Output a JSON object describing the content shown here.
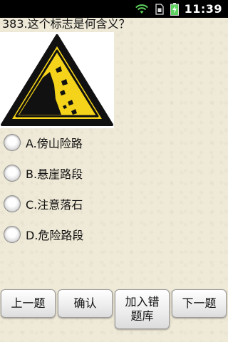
{
  "status_bar": {
    "time": "11:39",
    "icons": [
      "wifi-icon",
      "sim-icon",
      "battery-charging-icon"
    ]
  },
  "question": {
    "text": "383.这个标志是何含义？"
  },
  "sign": {
    "icon": "falling-rocks-warning-sign",
    "colors": {
      "yellow": "#f4d31a",
      "black": "#111111"
    }
  },
  "options": [
    {
      "label": "A.傍山险路"
    },
    {
      "label": "B.悬崖路段"
    },
    {
      "label": "C.注意落石"
    },
    {
      "label": "D.危险路段"
    }
  ],
  "buttons": {
    "prev": "上一题",
    "confirm": "确认",
    "add_wrong_line1": "加入错",
    "add_wrong_line2": "题库",
    "next": "下一题"
  }
}
